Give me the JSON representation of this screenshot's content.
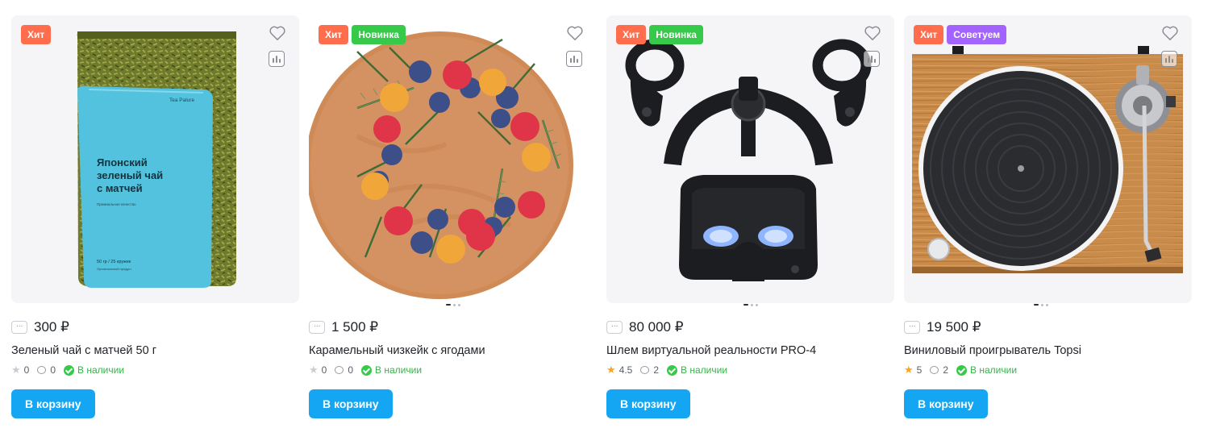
{
  "colors": {
    "badge_hit": "#ff6d4d",
    "badge_new": "#37c94a",
    "badge_recommended": "#a363ff",
    "button": "#14a6f2",
    "in_stock": "#37c94a",
    "rating_star": "#f5a623"
  },
  "products": [
    {
      "badges": [
        "Хит"
      ],
      "price": "300 ₽",
      "title": "Зеленый чай с матчей 50 г",
      "rating": "0",
      "reviews": "0",
      "availability": "В наличии",
      "cart_label": "В корзину",
      "package": {
        "brand": "Tea Palure",
        "name_line1": "Японский",
        "name_line2": "зеленый чай",
        "name_line3": "с матчей",
        "subtitle": "Премиальное качество",
        "weight": "50 гр / 25 кружек",
        "note": "Оригинальный продукт"
      }
    },
    {
      "badges": [
        "Хит",
        "Новинка"
      ],
      "price": "1 500 ₽",
      "title": "Карамельный чизкейк с ягодами",
      "rating": "0",
      "reviews": "0",
      "availability": "В наличии",
      "cart_label": "В корзину"
    },
    {
      "badges": [
        "Хит",
        "Новинка"
      ],
      "price": "80 000 ₽",
      "title": "Шлем виртуальной реальности PRO-4",
      "rating": "4.5",
      "reviews": "2",
      "availability": "В наличии",
      "cart_label": "В корзину"
    },
    {
      "badges": [
        "Хит",
        "Советуем"
      ],
      "price": "19 500 ₽",
      "title": "Виниловый проигрыватель Topsi",
      "rating": "5",
      "reviews": "2",
      "availability": "В наличии",
      "cart_label": "В корзину"
    }
  ]
}
